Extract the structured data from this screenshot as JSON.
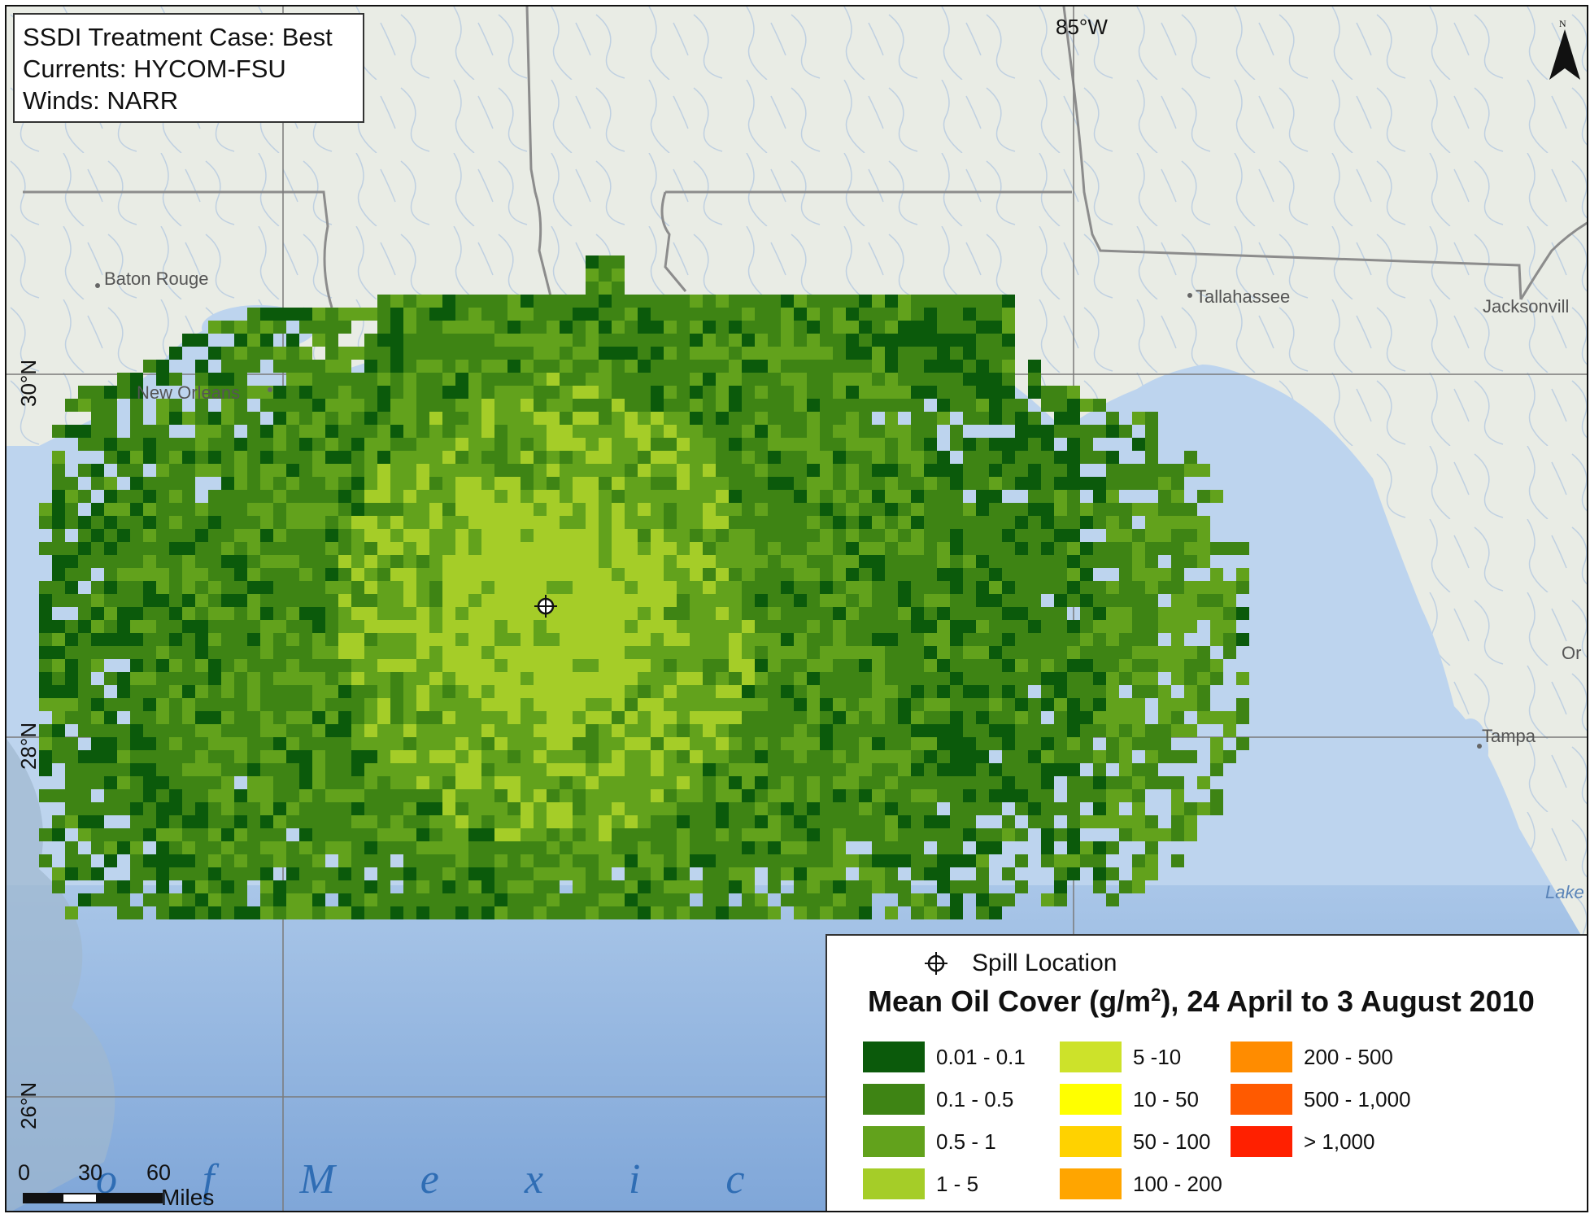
{
  "map": {
    "info_box": {
      "line1": "SSDI Treatment Case: Best",
      "line2": "Currents: HYCOM-FSU",
      "line3": "Winds: NARR"
    },
    "graticule": {
      "lon_label": "85°W",
      "lat_labels": [
        "30°N",
        "28°N",
        "26°N"
      ]
    },
    "places": {
      "baton_rouge": "Baton Rouge",
      "new_orleans": "New Orleans",
      "tallahassee": "Tallahassee",
      "jacksonville": "Jacksonvill",
      "orlando_partial": "Or",
      "tampa": "Tampa",
      "lake_partial": "Lake"
    },
    "sea_label": "o f   M e x i c o",
    "north_label": "N",
    "colors": {
      "land": "#e9ece5",
      "water": "#bdd4ee",
      "deep_water": "#8fb3df",
      "oil_01": "#0b5a0b",
      "oil_05": "#3e8414",
      "oil_1": "#62a21c",
      "oil_5": "#a5cd28"
    }
  },
  "legend": {
    "spill_label": "Spill Location",
    "title_main": "Mean Oil Cover (g/m",
    "title_sup": "2",
    "title_tail": "), 24 April to 3 August 2010",
    "classes": [
      {
        "label": "0.01 - 0.1",
        "color": "#0b5a0b"
      },
      {
        "label": "0.1 - 0.5",
        "color": "#3e8414"
      },
      {
        "label": "0.5 - 1",
        "color": "#62a21c"
      },
      {
        "label": "1 - 5",
        "color": "#a5cd28"
      },
      {
        "label": "5 -10",
        "color": "#cde22a"
      },
      {
        "label": "10 - 50",
        "color": "#ffff00"
      },
      {
        "label": "50 - 100",
        "color": "#ffd200"
      },
      {
        "label": "100 - 200",
        "color": "#ffa500"
      },
      {
        "label": "200 - 500",
        "color": "#ff8c00"
      },
      {
        "label": "500 - 1,000",
        "color": "#ff5a00"
      },
      {
        "label": "> 1,000",
        "color": "#ff2000"
      }
    ]
  },
  "scale_bar": {
    "tick_0": "0",
    "tick_1": "30",
    "tick_2": "60",
    "unit": "Miles"
  }
}
